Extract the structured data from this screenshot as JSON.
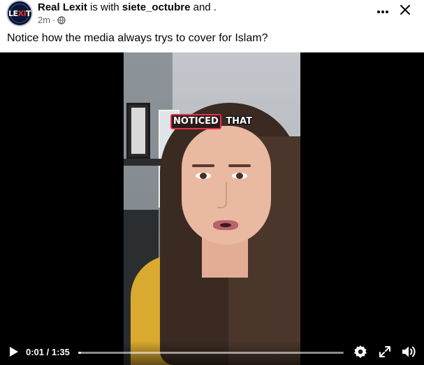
{
  "post": {
    "author": "Real Lexit",
    "with_text": " is with ",
    "tagged_user": "siete_octubre",
    "and_text": " and .",
    "timestamp": "2m",
    "separator": "·",
    "privacy_icon": "globe-icon",
    "caption": "Notice how the media always trys to cover for Islam?",
    "avatar": {
      "logo_letters_left": "LE",
      "logo_letters_mid": "XI",
      "logo_letters_right": "T"
    }
  },
  "header_actions": {
    "more_icon": "more-horizontal-icon",
    "close_icon": "close-icon"
  },
  "video": {
    "subtitle_words": [
      "NOTICED",
      "THAT"
    ],
    "highlight_color": "#e6324c",
    "current_time": "0:01",
    "duration": "1:35",
    "time_display": "0:01 / 1:35",
    "progress_fraction": 0.01,
    "controls": {
      "play_icon": "play-icon",
      "settings_icon": "gear-icon",
      "fullscreen_icon": "expand-icon",
      "volume_icon": "volume-icon"
    }
  }
}
